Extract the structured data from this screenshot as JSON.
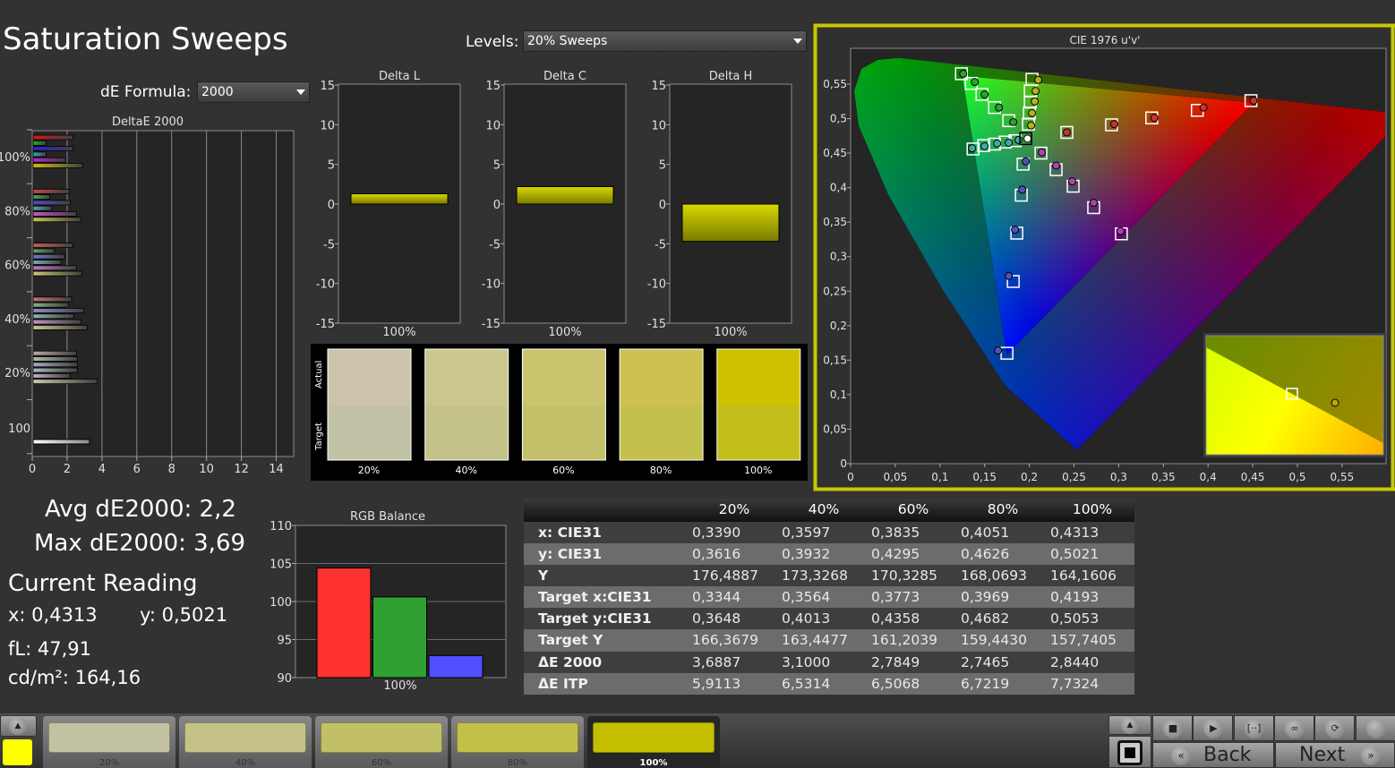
{
  "title": "Saturation Sweeps",
  "levels": {
    "label": "Levels:",
    "value": "20% Sweeps"
  },
  "de_formula": {
    "label": "dE Formula:",
    "value": "2000"
  },
  "summary": {
    "avg": "Avg dE2000: 2,2",
    "max": "Max dE2000: 3,69",
    "current_reading": "Current Reading",
    "x": "x: 0,4313",
    "y": "y: 0,5021",
    "fl": "fL: 47,91",
    "cdm2": "cd/m²: 164,16"
  },
  "chart_data": [
    {
      "id": "deltae",
      "type": "bar",
      "orientation": "horizontal",
      "title": "DeltaE 2000",
      "xlim": [
        0,
        15
      ],
      "xticks": [
        "0",
        "2",
        "4",
        "6",
        "8",
        "10",
        "12",
        "14"
      ],
      "grid": true,
      "groups": [
        {
          "label": "100%",
          "values": [
            2.28,
            0.74,
            2.28,
            0.74,
            1.86,
            2.84
          ],
          "colors": [
            "#d01818",
            "#20b020",
            "#2424c4",
            "#30b4b4",
            "#c420c4",
            "#c8c010"
          ]
        },
        {
          "label": "80%",
          "values": [
            2.09,
            0.95,
            2.14,
            1.07,
            2.49,
            2.75
          ],
          "colors": [
            "#c84444",
            "#44a844",
            "#4c4cc4",
            "#54a8b0",
            "#c454c4",
            "#c8c44c"
          ]
        },
        {
          "label": "60%",
          "values": [
            2.28,
            1.23,
            1.81,
            1.6,
            2.49,
            2.78
          ],
          "colors": [
            "#c85858",
            "#5cac5c",
            "#7474c8",
            "#74acb8",
            "#c474c4",
            "#c8c874"
          ]
        },
        {
          "label": "40%",
          "values": [
            2.21,
            2.02,
            2.91,
            2.33,
            2.75,
            3.1
          ],
          "colors": [
            "#c47474",
            "#84b484",
            "#8c8cc8",
            "#94b4b4",
            "#c494c4",
            "#c8c894"
          ]
        },
        {
          "label": "20%",
          "values": [
            2.49,
            2.54,
            2.54,
            2.54,
            2.12,
            3.69
          ],
          "colors": [
            "#c4a4a4",
            "#acc4a4",
            "#acacc8",
            "#acbcbc",
            "#c4acc4",
            "#c8c8ac"
          ]
        }
      ],
      "white": {
        "label": "100",
        "value": 3.23,
        "color": "#ffffff"
      }
    },
    {
      "id": "delta_l",
      "type": "bar",
      "title": "Delta L",
      "ylim": [
        -15,
        15
      ],
      "yticks": [
        "15",
        "10",
        "5",
        "0",
        "-5",
        "-10",
        "-15"
      ],
      "categories": [
        "100%"
      ],
      "values": [
        1.3
      ],
      "color": "#c8c800"
    },
    {
      "id": "delta_c",
      "type": "bar",
      "title": "Delta C",
      "ylim": [
        -15,
        15
      ],
      "yticks": [
        "15",
        "10",
        "5",
        "0",
        "-5",
        "-10",
        "-15"
      ],
      "categories": [
        "100%"
      ],
      "values": [
        2.2
      ],
      "color": "#c8c800"
    },
    {
      "id": "delta_h",
      "type": "bar",
      "title": "Delta H",
      "ylim": [
        -15,
        15
      ],
      "yticks": [
        "15",
        "10",
        "5",
        "0",
        "-5",
        "-10",
        "-15"
      ],
      "categories": [
        "100%"
      ],
      "values": [
        -4.7
      ],
      "color": "#c8c800"
    },
    {
      "id": "rgb_balance",
      "type": "bar",
      "title": "RGB Balance",
      "ylim": [
        90,
        110
      ],
      "yticks": [
        "110",
        "105",
        "100",
        "95",
        "90"
      ],
      "categories": [
        "100%"
      ],
      "series": [
        {
          "values": [
            104.4
          ],
          "color": "#ff3030"
        },
        {
          "values": [
            100.6
          ],
          "color": "#30a030"
        },
        {
          "values": [
            92.9
          ],
          "color": "#5050ff"
        }
      ]
    },
    {
      "id": "cie",
      "type": "scatter",
      "title": "CIE 1976 u'v'",
      "xlim": [
        0,
        0.6
      ],
      "ylim": [
        0,
        0.586
      ],
      "xticks": [
        "0",
        "0,05",
        "0,1",
        "0,15",
        "0,2",
        "0,25",
        "0,3",
        "0,35",
        "0,4",
        "0,45",
        "0,5",
        "0,55"
      ],
      "yticks": [
        "0",
        "0,05",
        "0,1",
        "0,15",
        "0,2",
        "0,25",
        "0,3",
        "0,35",
        "0,4",
        "0,45",
        "0,5",
        "0,55"
      ],
      "gamut": {
        "red": [
          0.451,
          0.523
        ],
        "green": [
          0.125,
          0.562
        ],
        "blue": [
          0.175,
          0.158
        ]
      },
      "series": [
        {
          "color": "#d03030",
          "target": [
            [
              0.448,
              0.526
            ],
            [
              0.388,
              0.512
            ],
            [
              0.337,
              0.501
            ],
            [
              0.292,
              0.491
            ],
            [
              0.242,
              0.48
            ]
          ],
          "measured": [
            [
              0.451,
              0.526
            ],
            [
              0.395,
              0.516
            ],
            [
              0.34,
              0.501
            ],
            [
              0.295,
              0.492
            ],
            [
              0.242,
              0.48
            ]
          ]
        },
        {
          "color": "#30a030",
          "target": [
            [
              0.124,
              0.565
            ],
            [
              0.135,
              0.551
            ],
            [
              0.147,
              0.535
            ],
            [
              0.161,
              0.516
            ],
            [
              0.177,
              0.497
            ]
          ],
          "measured": [
            [
              0.126,
              0.565
            ],
            [
              0.139,
              0.553
            ],
            [
              0.15,
              0.535
            ],
            [
              0.166,
              0.516
            ],
            [
              0.182,
              0.495
            ]
          ]
        },
        {
          "color": "#5050c0",
          "target": [
            [
              0.175,
              0.16
            ],
            [
              0.182,
              0.264
            ],
            [
              0.186,
              0.334
            ],
            [
              0.191,
              0.389
            ],
            [
              0.193,
              0.434
            ]
          ],
          "measured": [
            [
              0.165,
              0.164
            ],
            [
              0.177,
              0.272
            ],
            [
              0.184,
              0.339
            ],
            [
              0.192,
              0.397
            ],
            [
              0.196,
              0.438
            ]
          ]
        },
        {
          "color": "#40a8a8",
          "target": [
            [
              0.137,
              0.456
            ],
            [
              0.149,
              0.461
            ],
            [
              0.161,
              0.463
            ],
            [
              0.173,
              0.466
            ],
            [
              0.184,
              0.468
            ]
          ],
          "measured": [
            [
              0.136,
              0.457
            ],
            [
              0.15,
              0.46
            ],
            [
              0.164,
              0.464
            ],
            [
              0.177,
              0.465
            ],
            [
              0.188,
              0.469
            ]
          ]
        },
        {
          "color": "#b040b0",
          "target": [
            [
              0.303,
              0.333
            ],
            [
              0.272,
              0.371
            ],
            [
              0.249,
              0.402
            ],
            [
              0.23,
              0.426
            ],
            [
              0.213,
              0.45
            ]
          ],
          "measured": [
            [
              0.302,
              0.337
            ],
            [
              0.272,
              0.378
            ],
            [
              0.248,
              0.409
            ],
            [
              0.23,
              0.432
            ],
            [
              0.214,
              0.451
            ]
          ]
        },
        {
          "color": "#b8b020",
          "target": [
            [
              0.203,
              0.557
            ],
            [
              0.201,
              0.54
            ],
            [
              0.201,
              0.524
            ],
            [
              0.2,
              0.508
            ],
            [
              0.199,
              0.492
            ]
          ],
          "measured": [
            [
              0.21,
              0.556
            ],
            [
              0.207,
              0.54
            ],
            [
              0.206,
              0.525
            ],
            [
              0.203,
              0.508
            ],
            [
              0.202,
              0.49
            ]
          ]
        }
      ],
      "white": {
        "color": "#ffffff",
        "target": [
          0.196,
          0.471
        ],
        "measured": [
          0.198,
          0.471
        ]
      }
    }
  ],
  "swatches": {
    "actual_label": "Actual",
    "target_label": "Target",
    "items": [
      {
        "label": "20%",
        "actual": "#cbc4aa",
        "target": "#c1c1a6"
      },
      {
        "label": "40%",
        "actual": "#cbc58e",
        "target": "#c3c289"
      },
      {
        "label": "60%",
        "actual": "#cbc46f",
        "target": "#c3c069"
      },
      {
        "label": "80%",
        "actual": "#cdc14f",
        "target": "#c3c04b"
      },
      {
        "label": "100%",
        "actual": "#cdc100",
        "target": "#c2be1a"
      }
    ]
  },
  "table": {
    "columns": [
      "20%",
      "40%",
      "60%",
      "80%",
      "100%"
    ],
    "rows": [
      {
        "label": "x: CIE31",
        "values": [
          "0,3390",
          "0,3597",
          "0,3835",
          "0,4051",
          "0,4313"
        ]
      },
      {
        "label": "y: CIE31",
        "values": [
          "0,3616",
          "0,3932",
          "0,4295",
          "0,4626",
          "0,5021"
        ]
      },
      {
        "label": "Y",
        "values": [
          "176,4887",
          "173,3268",
          "170,3285",
          "168,0693",
          "164,1606"
        ]
      },
      {
        "label": "Target x:CIE31",
        "values": [
          "0,3344",
          "0,3564",
          "0,3773",
          "0,3969",
          "0,4193"
        ]
      },
      {
        "label": "Target y:CIE31",
        "values": [
          "0,3648",
          "0,4013",
          "0,4358",
          "0,4682",
          "0,5053"
        ]
      },
      {
        "label": "Target Y",
        "values": [
          "166,3679",
          "163,4477",
          "161,2039",
          "159,4430",
          "157,7405"
        ]
      },
      {
        "label": "ΔE 2000",
        "values": [
          "3,6887",
          "3,1000",
          "2,7849",
          "2,7465",
          "2,8440"
        ]
      },
      {
        "label": "ΔE ITP",
        "values": [
          "5,9113",
          "6,5314",
          "6,5068",
          "6,7219",
          "7,7324"
        ]
      }
    ]
  },
  "bottom": {
    "current_color": "#ffff00",
    "tiles": [
      {
        "label": "20%",
        "color": "#c2c1a2"
      },
      {
        "label": "40%",
        "color": "#c4c286"
      },
      {
        "label": "60%",
        "color": "#c2c067"
      },
      {
        "label": "80%",
        "color": "#c3c04a"
      },
      {
        "label": "100%",
        "color": "#c4be00",
        "selected": true
      }
    ],
    "controls": {
      "stop_icon": "■",
      "play_icon": "▶",
      "range_icon": "[··]",
      "loop_icon": "∞",
      "refresh_icon": "⟳",
      "back_icon": "«",
      "back_label": "Back",
      "next_label": "Next",
      "next_icon": "»"
    }
  },
  "accent": "#c8c800"
}
